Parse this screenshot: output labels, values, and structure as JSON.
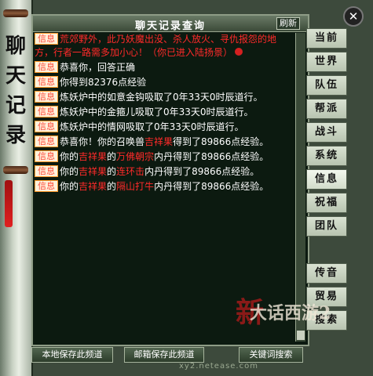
{
  "window": {
    "title_vertical": "聊\n天\n记\n录",
    "close_symbol": "✕"
  },
  "panel": {
    "title": "聊天记录查询",
    "refresh": "刷新"
  },
  "messages": [
    {
      "tag": "信息",
      "text": "荒郊野外，此乃妖魔出没、杀人放火、寻仇报怨的地方，行者一路需多加小心！（你已进入陆扬景）",
      "style": "red"
    },
    {
      "tag": "信息",
      "text": "恭喜你，回答正确"
    },
    {
      "tag": "信息",
      "text": "你得到82376点经验"
    },
    {
      "tag": "信息",
      "text": "炼妖炉中的如意金钩吸取了0年33天0时辰道行。"
    },
    {
      "tag": "信息",
      "text": "炼妖炉中的金箍儿吸取了0年33天0时辰道行。"
    },
    {
      "tag": "信息",
      "text": "炼妖炉中的情网吸取了0年33天0时辰道行。"
    },
    {
      "tag": "信息",
      "pre": "恭喜你！你的召唤兽",
      "name": "吉祥果",
      "post": "得到了89866点经验。"
    },
    {
      "tag": "信息",
      "pre": "你的",
      "name": "吉祥果",
      "mid": "的",
      "item": "万佛朝宗",
      "post": "内丹得到了89866点经验。"
    },
    {
      "tag": "信息",
      "pre": "你的",
      "name": "吉祥果",
      "mid": "的",
      "item": "连环击",
      "post": "内丹得到了89866点经验。"
    },
    {
      "tag": "信息",
      "pre": "你的",
      "name": "吉祥果",
      "mid": "的",
      "item": "隔山打牛",
      "post": "内丹得到了89866点经验。"
    }
  ],
  "tabs": [
    "当前",
    "世界",
    "队伍",
    "帮派",
    "战斗",
    "系统",
    "信息",
    "祝福",
    "团队",
    "传音",
    "贸易",
    "搜索"
  ],
  "buttons": {
    "save_local": "本地保存此频道",
    "save_mail": "邮箱保存此频道",
    "keyword": "关键词搜索"
  },
  "watermark": "xy2.netease.com",
  "logo": {
    "red_char": "新",
    "text": "大话西游2"
  },
  "colors": {
    "tag_text": "#ff4a3a",
    "highlight": "#ff2a2a",
    "panel_bg": "#0c1a10"
  }
}
